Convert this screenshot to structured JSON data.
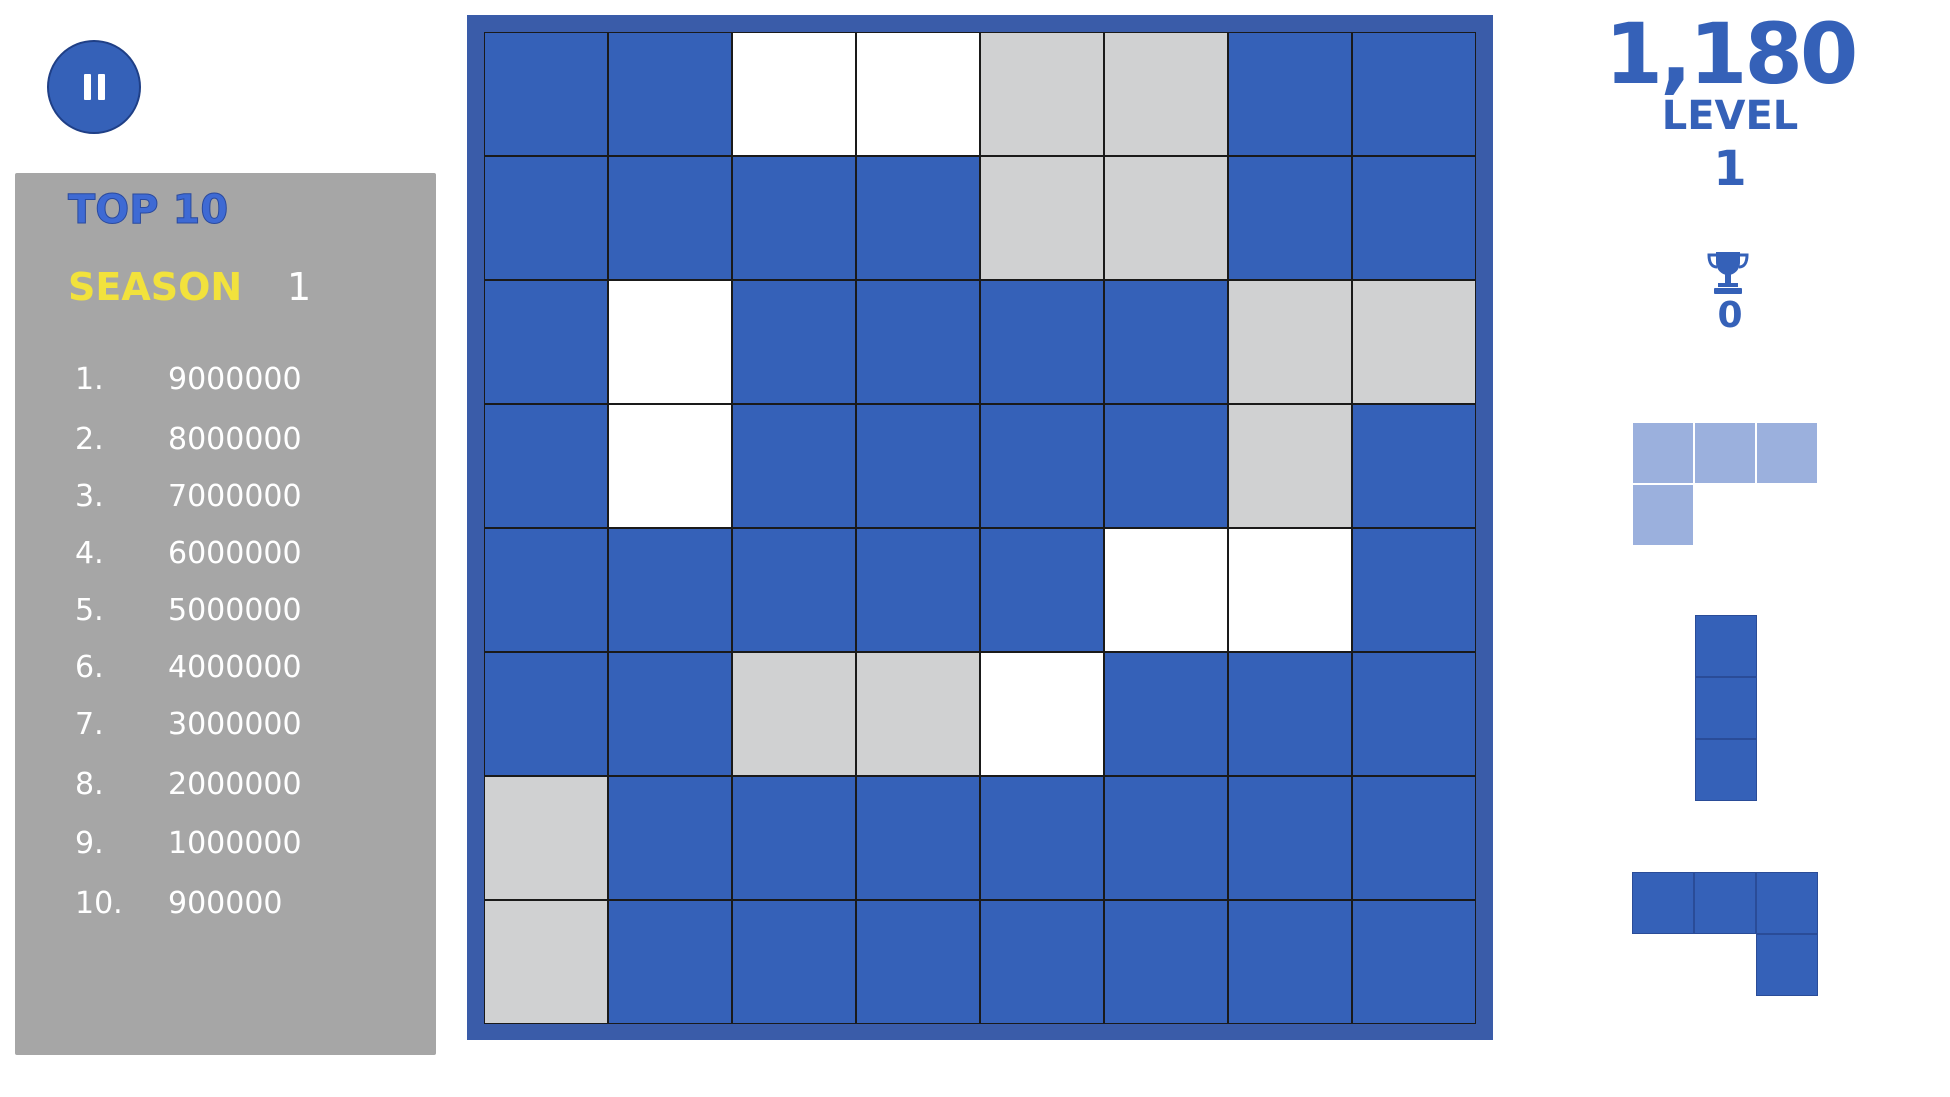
{
  "pause_button": {
    "icon": "pause-icon"
  },
  "leaderboard": {
    "title": "TOP 10",
    "season_label": "SEASON",
    "season_value": "1",
    "entries": [
      {
        "rank": "1.",
        "score": "9000000"
      },
      {
        "rank": "2.",
        "score": "8000000"
      },
      {
        "rank": "3.",
        "score": "7000000"
      },
      {
        "rank": "4.",
        "score": "6000000"
      },
      {
        "rank": "5.",
        "score": "5000000"
      },
      {
        "rank": "6.",
        "score": "4000000"
      },
      {
        "rank": "7.",
        "score": "3000000"
      },
      {
        "rank": "8.",
        "score": "2000000"
      },
      {
        "rank": "9.",
        "score": "1000000"
      },
      {
        "rank": "10.",
        "score": "900000"
      }
    ]
  },
  "hud": {
    "score": "1,180",
    "level_label": "LEVEL",
    "level_value": "1",
    "trophy_icon": "trophy-icon",
    "trophies": "0"
  },
  "board": {
    "size": 8,
    "legend": {
      "b": "filled",
      "w": "empty",
      "g": "highlight"
    },
    "rows": [
      [
        "b",
        "b",
        "w",
        "w",
        "g",
        "g",
        "b",
        "b"
      ],
      [
        "b",
        "b",
        "b",
        "b",
        "g",
        "g",
        "b",
        "b"
      ],
      [
        "b",
        "w",
        "b",
        "b",
        "b",
        "b",
        "g",
        "g"
      ],
      [
        "b",
        "w",
        "b",
        "b",
        "b",
        "b",
        "g",
        "b"
      ],
      [
        "b",
        "b",
        "b",
        "b",
        "b",
        "w",
        "w",
        "b"
      ],
      [
        "b",
        "b",
        "g",
        "g",
        "w",
        "b",
        "b",
        "b"
      ],
      [
        "g",
        "b",
        "b",
        "b",
        "b",
        "b",
        "b",
        "b"
      ],
      [
        "g",
        "b",
        "b",
        "b",
        "b",
        "b",
        "b",
        "b"
      ]
    ]
  },
  "next_pieces": [
    {
      "name": "l-piece",
      "style": "light",
      "cells": [
        [
          0,
          0
        ],
        [
          1,
          0
        ],
        [
          2,
          0
        ],
        [
          0,
          1
        ]
      ]
    },
    {
      "name": "i-piece-vertical",
      "style": "dark",
      "cells": [
        [
          0,
          0
        ],
        [
          0,
          1
        ],
        [
          0,
          2
        ]
      ]
    },
    {
      "name": "j-piece",
      "style": "dark",
      "cells": [
        [
          0,
          0
        ],
        [
          1,
          0
        ],
        [
          2,
          0
        ],
        [
          2,
          1
        ]
      ]
    }
  ],
  "colors": {
    "brand_blue": "#3561b8",
    "board_frame": "#3a5ca9",
    "highlight_gray": "#d0d1d2",
    "panel_gray": "#a6a6a6",
    "season_yellow": "#f2e23c",
    "light_piece": "#9bb0dd"
  }
}
